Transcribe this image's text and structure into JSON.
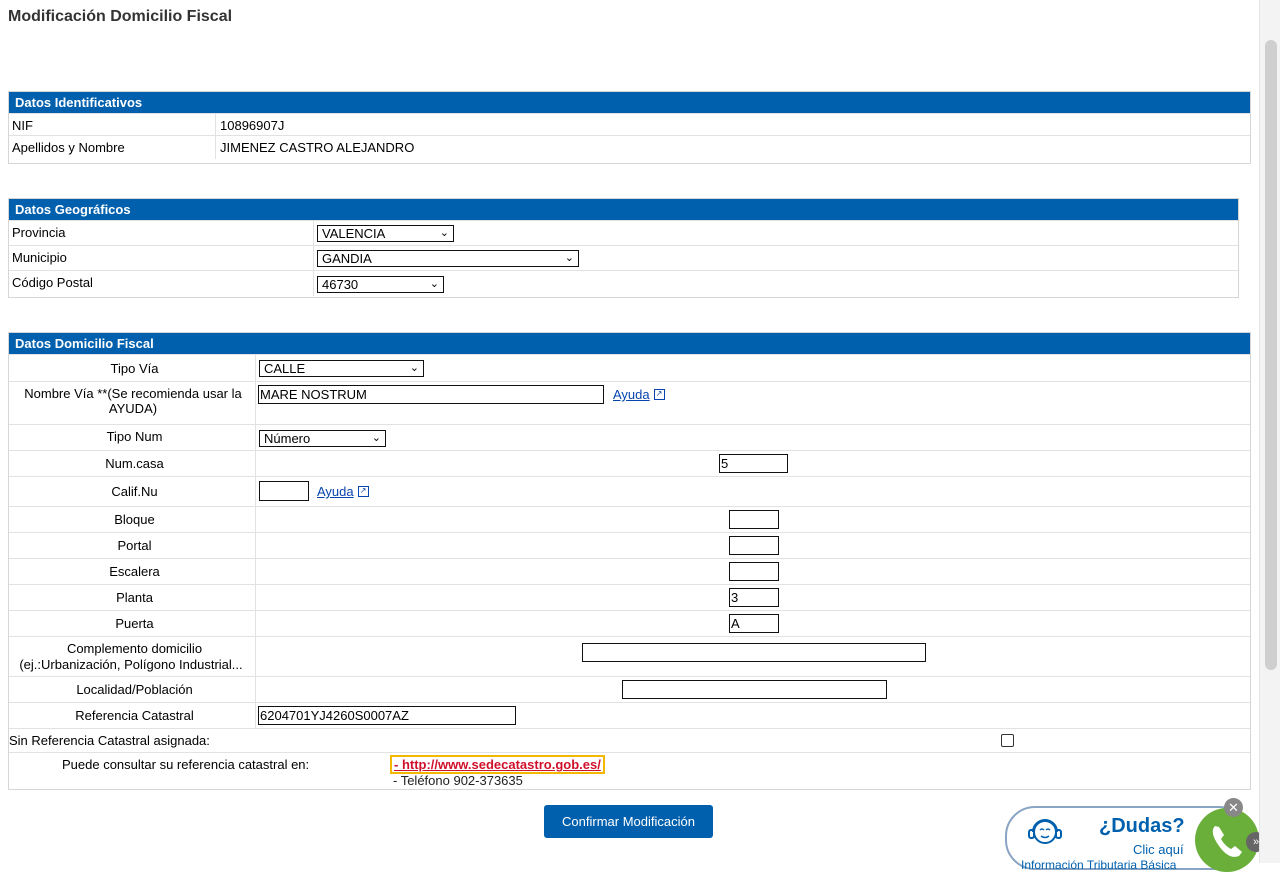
{
  "page_title": "Modificación Domicilio Fiscal",
  "identificativos": {
    "header": "Datos Identificativos",
    "nif_label": "NIF",
    "nif_value": "10896907J",
    "nombre_label": "Apellidos y Nombre",
    "nombre_value": "JIMENEZ CASTRO ALEJANDRO"
  },
  "geograficos": {
    "header": "Datos Geográficos",
    "provincia_label": "Provincia",
    "provincia_value": "VALENCIA",
    "municipio_label": "Municipio",
    "municipio_value": "GANDIA",
    "cp_label": "Código Postal",
    "cp_value": "46730"
  },
  "domicilio": {
    "header": "Datos Domicilio Fiscal",
    "tipo_via_label": "Tipo Vía",
    "tipo_via_value": "CALLE",
    "nombre_via_label": "Nombre Vía **(Se recomienda usar la AYUDA)",
    "nombre_via_value": "MARE NOSTRUM",
    "ayuda_label": "Ayuda",
    "tipo_num_label": "Tipo Num",
    "tipo_num_value": "Número",
    "num_casa_label": "Num.casa",
    "num_casa_value": "5",
    "calif_label": "Calif.Nu",
    "calif_value": "",
    "bloque_label": "Bloque",
    "bloque_value": "",
    "portal_label": "Portal",
    "portal_value": "",
    "escalera_label": "Escalera",
    "escalera_value": "",
    "planta_label": "Planta",
    "planta_value": "3",
    "puerta_label": "Puerta",
    "puerta_value": "A",
    "complemento_label_1": "Complemento domicilio",
    "complemento_label_2": "(ej.:Urbanización, Polígono Industrial...",
    "complemento_value": "",
    "localidad_label": "Localidad/Población",
    "localidad_value": "",
    "ref_catastral_label": "Referencia Catastral",
    "ref_catastral_value": "6204701YJ4260S0007AZ",
    "sin_ref_label": "Sin Referencia Catastral asignada:",
    "consulta_label": "Puede consultar su referencia catastral en:",
    "consulta_link": "- http://www.sedecatastro.gob.es/",
    "consulta_phone": "- Teléfono 902-373635"
  },
  "confirm_button": "Confirmar Modificación",
  "help_widget": {
    "title": "¿Dudas?",
    "subtitle": "Clic aquí",
    "footer": "Información Tributaria Básica"
  },
  "colors": {
    "header_bg": "#0060ad",
    "link": "#0645ad",
    "link_alert": "#d0102a",
    "highlight": "#f5b800"
  }
}
